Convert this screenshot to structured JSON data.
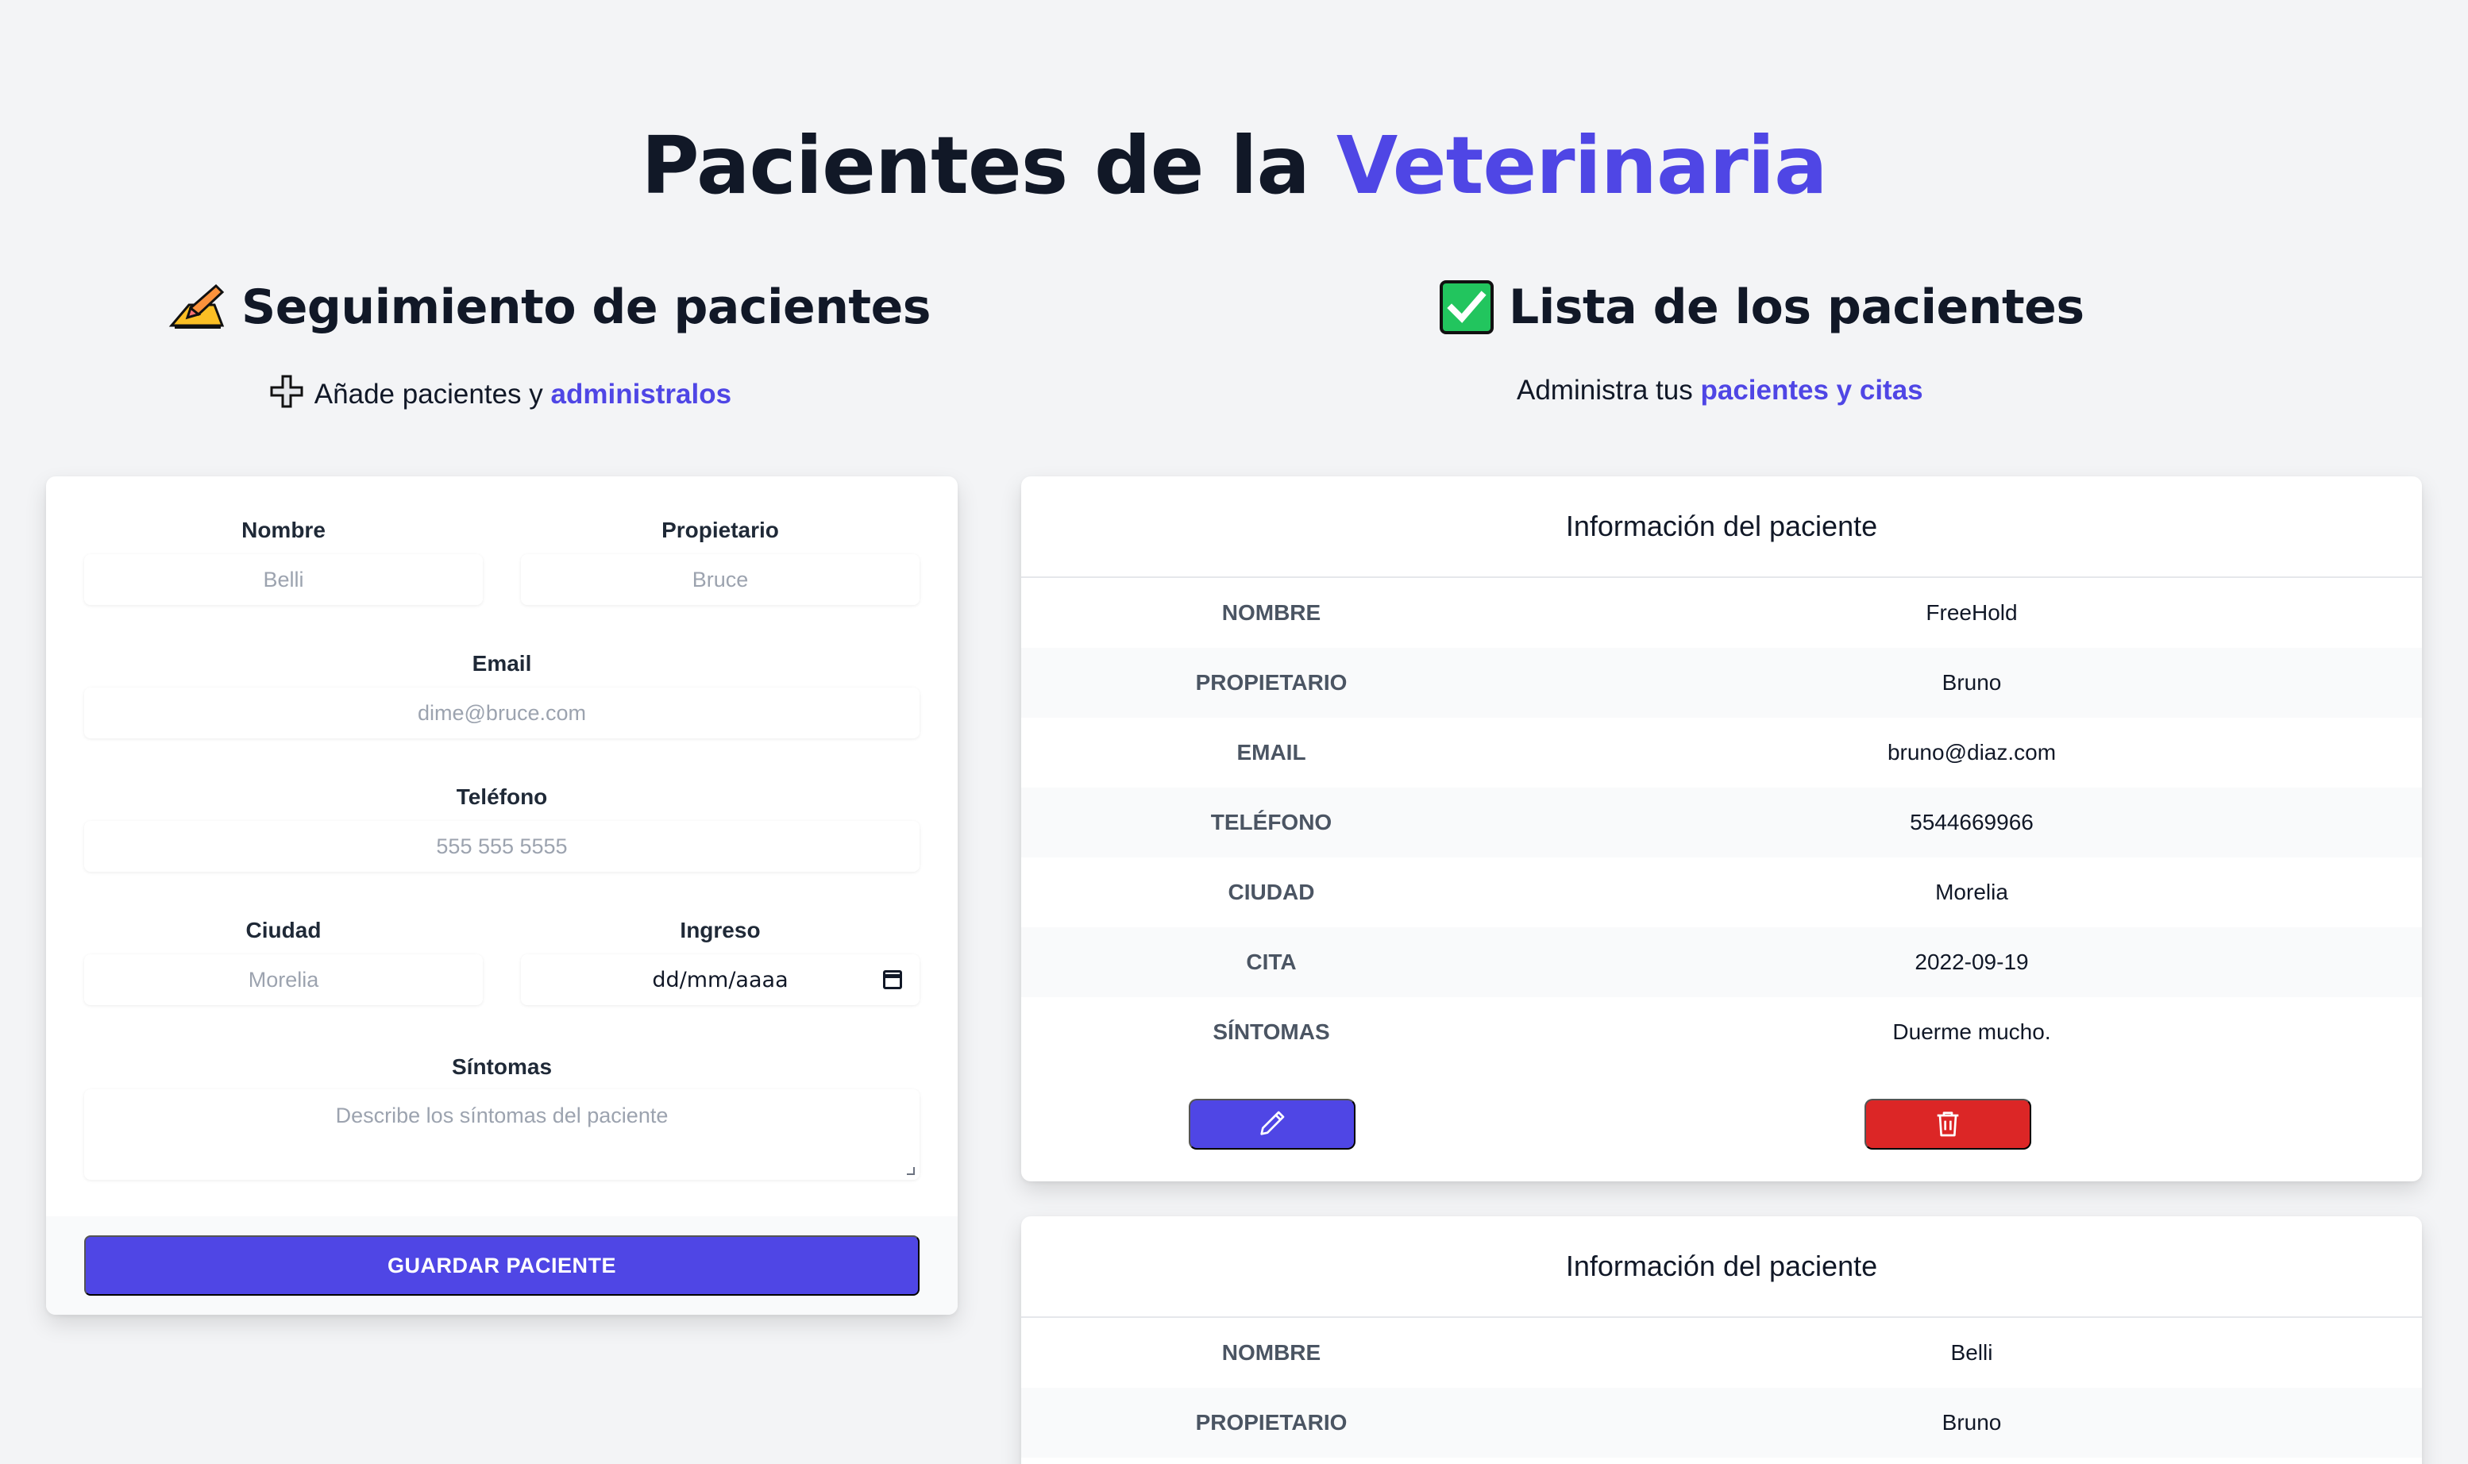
{
  "header": {
    "title_prefix": "Pacientes de la",
    "title_accent": "Veterinaria"
  },
  "left_section": {
    "heading": "Seguimiento de pacientes",
    "heading_icon": "writing-hand-icon",
    "sub_icon": "plus-icon",
    "sub_text": "Añade pacientes y",
    "sub_accent": "administralos"
  },
  "right_section": {
    "heading": "Lista de los pacientes",
    "heading_icon": "check-mark-icon",
    "sub_text": "Administra tus",
    "sub_accent": "pacientes y citas"
  },
  "form": {
    "nombre_label": "Nombre",
    "nombre_placeholder": "Belli",
    "propietario_label": "Propietario",
    "propietario_placeholder": "Bruce",
    "email_label": "Email",
    "email_placeholder": "dime@bruce.com",
    "telefono_label": "Teléfono",
    "telefono_placeholder": "555 555 5555",
    "ciudad_label": "Ciudad",
    "ciudad_placeholder": "Morelia",
    "ingreso_label": "Ingreso",
    "ingreso_value": "dd/mm/aaaa",
    "sintomas_label": "Síntomas",
    "sintomas_placeholder": "Describe los síntomas del paciente",
    "save_button": "GUARDAR PACIENTE"
  },
  "patients": [
    {
      "title": "Información del paciente",
      "rows": [
        {
          "key": "NOMBRE",
          "value": "FreeHold"
        },
        {
          "key": "PROPIETARIO",
          "value": "Bruno"
        },
        {
          "key": "EMAIL",
          "value": "bruno@diaz.com"
        },
        {
          "key": "TELÉFONO",
          "value": "5544669966"
        },
        {
          "key": "CIUDAD",
          "value": "Morelia"
        },
        {
          "key": "CITA",
          "value": "2022-09-19"
        },
        {
          "key": "SÍNTOMAS",
          "value": "Duerme mucho."
        }
      ]
    },
    {
      "title": "Información del paciente",
      "rows": [
        {
          "key": "NOMBRE",
          "value": "Belli"
        },
        {
          "key": "PROPIETARIO",
          "value": "Bruno"
        }
      ]
    }
  ],
  "colors": {
    "accent": "#4f46e5",
    "danger": "#dc2626",
    "background": "#f3f4f6"
  }
}
